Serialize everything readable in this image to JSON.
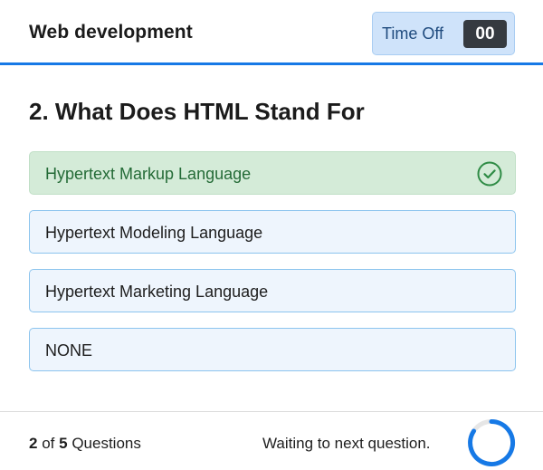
{
  "header": {
    "title": "Web development",
    "timer_label": "Time Off",
    "timer_value": "00"
  },
  "question": {
    "text": "2. What Does HTML Stand For"
  },
  "options": [
    {
      "label": "Hypertext Markup Language",
      "state": "correct",
      "icon": "check-circle-icon"
    },
    {
      "label": "Hypertext Modeling Language",
      "state": "default"
    },
    {
      "label": "Hypertext Marketing Language",
      "state": "default"
    },
    {
      "label": "NONE",
      "state": "default"
    }
  ],
  "footer": {
    "current": "2",
    "of_text": "of",
    "total": "5",
    "questions_label": "Questions",
    "waiting_text": "Waiting to next question.",
    "loader_icon": "loading-spinner-icon"
  },
  "colors": {
    "accent": "#1679e6",
    "correct_bg": "#d4ebd8",
    "correct_text": "#246b37",
    "option_bg": "#eef5fd",
    "option_border": "#8cc4ee",
    "timer_bg": "#cfe3fa",
    "timer_value_bg": "#353a40"
  }
}
